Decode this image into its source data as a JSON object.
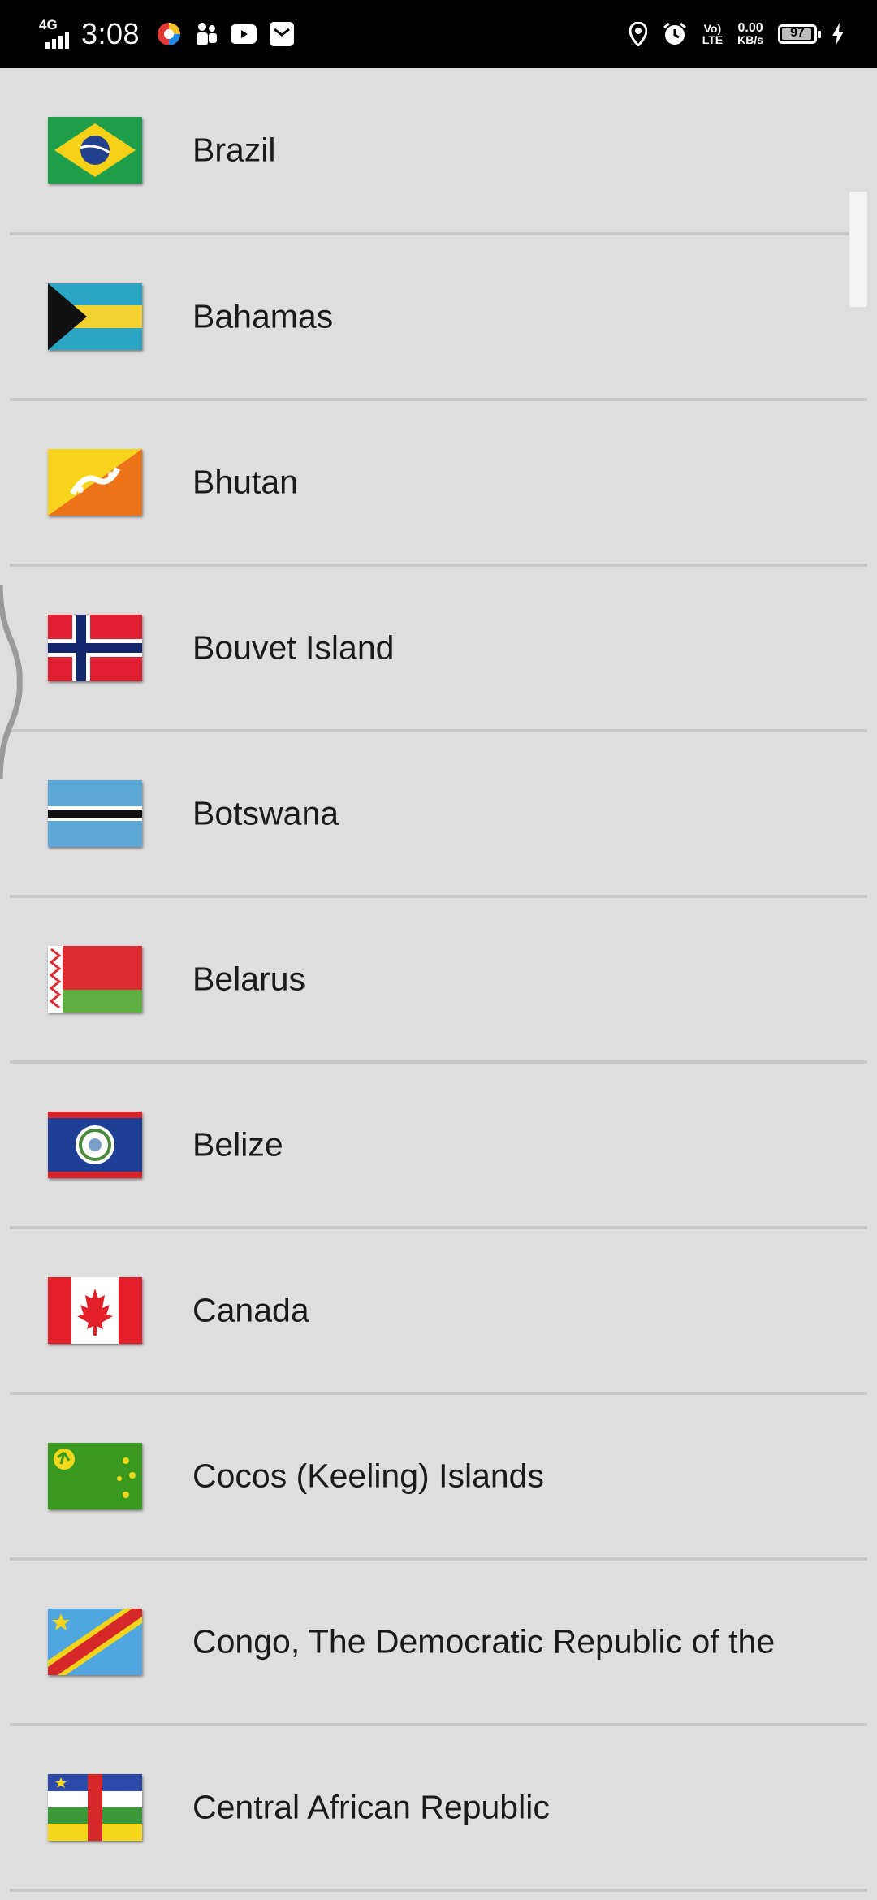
{
  "status_bar": {
    "network": "4G",
    "time": "3:08",
    "volte_line1": "Vo)",
    "volte_line2": "LTE",
    "speed_value": "0.00",
    "speed_unit": "KB/s",
    "battery": "97",
    "icons": [
      "signal-icon",
      "browser-app-icon",
      "teams-app-icon",
      "youtube-app-icon",
      "mail-app-icon",
      "location-icon",
      "alarm-icon",
      "charging-icon"
    ]
  },
  "countries": [
    {
      "name": "Brazil",
      "flag_icon": "brazil-flag-icon"
    },
    {
      "name": "Bahamas",
      "flag_icon": "bahamas-flag-icon"
    },
    {
      "name": "Bhutan",
      "flag_icon": "bhutan-flag-icon"
    },
    {
      "name": "Bouvet Island",
      "flag_icon": "bouvet-island-flag-icon"
    },
    {
      "name": "Botswana",
      "flag_icon": "botswana-flag-icon"
    },
    {
      "name": "Belarus",
      "flag_icon": "belarus-flag-icon"
    },
    {
      "name": "Belize",
      "flag_icon": "belize-flag-icon"
    },
    {
      "name": "Canada",
      "flag_icon": "canada-flag-icon"
    },
    {
      "name": "Cocos (Keeling) Islands",
      "flag_icon": "cocos-islands-flag-icon"
    },
    {
      "name": "Congo, The Democratic Republic of the",
      "flag_icon": "congo-drc-flag-icon"
    },
    {
      "name": "Central African Republic",
      "flag_icon": "central-african-republic-flag-icon"
    }
  ],
  "colors": {
    "background": "#dedede",
    "divider": "#c7c7c7",
    "status_bar": "#000000",
    "text": "#1a1a1a"
  }
}
